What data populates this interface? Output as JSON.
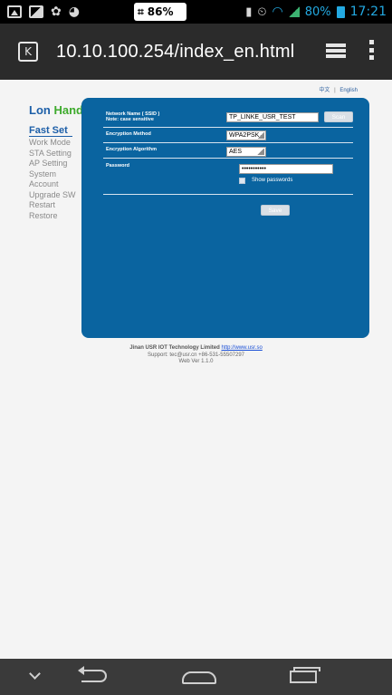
{
  "status_bar": {
    "center_glyph": "⌗",
    "center_text": "86%",
    "alarm_glyph": "⏲",
    "vibrate_glyph": "▮",
    "battery_pct": "80%",
    "time": "17:21"
  },
  "browser": {
    "url": "10.10.100.254/index_en.html",
    "tab_icon": "K"
  },
  "page": {
    "lang": {
      "zh": "中文",
      "en": "English",
      "separator": "|"
    },
    "logo": {
      "part1": "Lon",
      "part2": "Hand"
    },
    "nav": {
      "items": [
        "Fast Set",
        "Work Mode",
        "STA Setting",
        "AP Setting",
        "System",
        "Account",
        "Upgrade SW",
        "Restart",
        "Restore"
      ]
    },
    "form": {
      "ssid_label": "Network Name ( SSID )",
      "ssid_note": "Note: case sensitive",
      "ssid_value": "TP_LINKE_USR_TEST",
      "scan_button": "Scan",
      "encryption_method_label": "Encryption Method",
      "encryption_method_value": "WPA2PSK",
      "encryption_algorithm_label": "Encryption Algorithm",
      "encryption_algorithm_value": "AES",
      "password_label": "Password",
      "password_value": "•••••••••••",
      "show_passwords_label": "Show passwords",
      "save_button": "Save"
    },
    "footer": {
      "company": "Jinan USR IOT Technology Limited",
      "link": "http://www.usr.so",
      "support": "Support: tec@usr.cn +86-531-55507297",
      "version": "Web Ver 1.1.0"
    }
  },
  "colors": {
    "panel": "#0a64a0",
    "accent_blue": "#1d5fa8",
    "accent_green": "#3daa2c"
  }
}
